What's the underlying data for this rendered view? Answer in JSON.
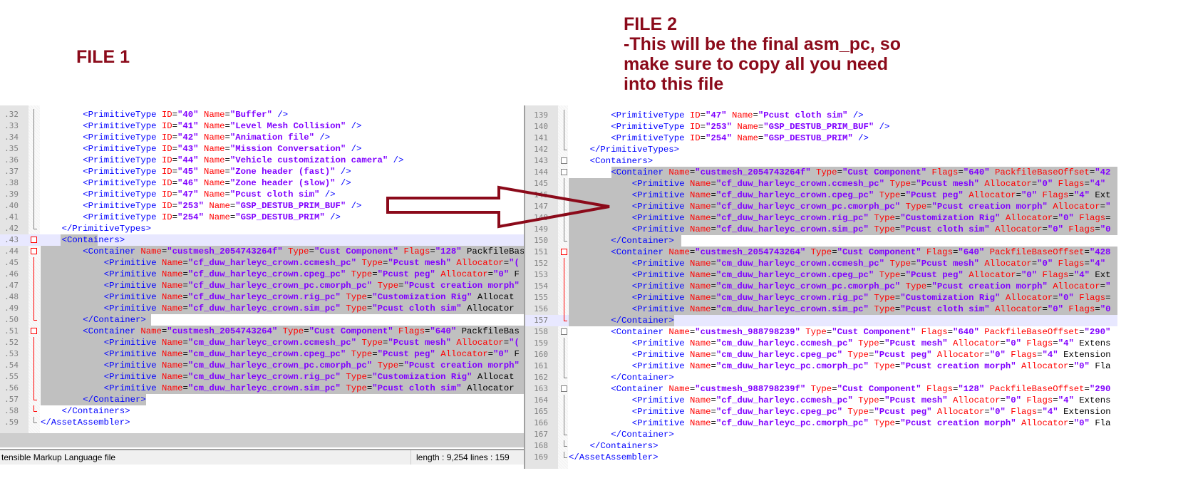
{
  "annotations": {
    "file1_title": "FILE 1",
    "file2_title": "FILE 2",
    "file2_note": [
      "-This will be the final asm_pc, so",
      "make sure to copy all you need",
      "into this file"
    ],
    "accent_color": "#8b0a1a",
    "arrow": "right-arrow-outline"
  },
  "left_editor": {
    "status": {
      "file_type": "tensible Markup Language file",
      "length": "length : 9,254",
      "lines": "lines : 159"
    },
    "lines": [
      {
        "n": ".32",
        "d": 2,
        "text": "<PrimitiveType ID=\"40\" Name=\"Buffer\" />"
      },
      {
        "n": ".33",
        "d": 2,
        "text": "<PrimitiveType ID=\"41\" Name=\"Level Mesh Collision\" />"
      },
      {
        "n": ".34",
        "d": 2,
        "text": "<PrimitiveType ID=\"42\" Name=\"Animation file\" />"
      },
      {
        "n": ".35",
        "d": 2,
        "text": "<PrimitiveType ID=\"43\" Name=\"Mission Conversation\" />"
      },
      {
        "n": ".36",
        "d": 2,
        "text": "<PrimitiveType ID=\"44\" Name=\"Vehicle customization camera\" />"
      },
      {
        "n": ".37",
        "d": 2,
        "text": "<PrimitiveType ID=\"45\" Name=\"Zone header (fast)\" />"
      },
      {
        "n": ".38",
        "d": 2,
        "text": "<PrimitiveType ID=\"46\" Name=\"Zone header (slow)\" />"
      },
      {
        "n": ".39",
        "d": 2,
        "text": "<PrimitiveType ID=\"47\" Name=\"Pcust cloth sim\" />"
      },
      {
        "n": ".40",
        "d": 2,
        "text": "<PrimitiveType ID=\"253\" Name=\"GSP_DESTUB_PRIM_BUF\" />"
      },
      {
        "n": ".41",
        "d": 2,
        "text": "<PrimitiveType ID=\"254\" Name=\"GSP_DESTUB_PRIM\" />"
      },
      {
        "n": ".42",
        "d": 1,
        "text": "</PrimitiveTypes>"
      },
      {
        "n": ".43",
        "d": 1,
        "text": "<Containers>"
      },
      {
        "n": ".44",
        "d": 2,
        "text": "<Container Name=\"custmesh_2054743264f\" Type=\"Cust Component\" Flags=\"128\" PackfileBas"
      },
      {
        "n": ".45",
        "d": 3,
        "text": "<Primitive Name=\"cf_duw_harleyc_crown.ccmesh_pc\" Type=\"Pcust mesh\" Allocator=\"("
      },
      {
        "n": ".46",
        "d": 3,
        "text": "<Primitive Name=\"cf_duw_harleyc_crown.cpeg_pc\" Type=\"Pcust peg\" Allocator=\"0\" F"
      },
      {
        "n": ".47",
        "d": 3,
        "text": "<Primitive Name=\"cf_duw_harleyc_crown_pc.cmorph_pc\" Type=\"Pcust creation morph\""
      },
      {
        "n": ".48",
        "d": 3,
        "text": "<Primitive Name=\"cf_duw_harleyc_crown.rig_pc\" Type=\"Customization Rig\" Allocat"
      },
      {
        "n": ".49",
        "d": 3,
        "text": "<Primitive Name=\"cf_duw_harleyc_crown.sim_pc\" Type=\"Pcust cloth sim\" Allocator"
      },
      {
        "n": ".50",
        "d": 2,
        "text": "</Container>"
      },
      {
        "n": ".51",
        "d": 2,
        "text": "<Container Name=\"custmesh_2054743264\" Type=\"Cust Component\" Flags=\"640\" PackfileBas"
      },
      {
        "n": ".52",
        "d": 3,
        "text": "<Primitive Name=\"cm_duw_harleyc_crown.ccmesh_pc\" Type=\"Pcust mesh\" Allocator=\"("
      },
      {
        "n": ".53",
        "d": 3,
        "text": "<Primitive Name=\"cm_duw_harleyc_crown.cpeg_pc\" Type=\"Pcust peg\" Allocator=\"0\" F"
      },
      {
        "n": ".54",
        "d": 3,
        "text": "<Primitive Name=\"cm_duw_harleyc_crown_pc.cmorph_pc\" Type=\"Pcust creation morph\""
      },
      {
        "n": ".55",
        "d": 3,
        "text": "<Primitive Name=\"cm_duw_harleyc_crown.rig_pc\" Type=\"Customization Rig\" Allocat"
      },
      {
        "n": ".56",
        "d": 3,
        "text": "<Primitive Name=\"cm_duw_harleyc_crown.sim_pc\" Type=\"Pcust cloth sim\" Allocator"
      },
      {
        "n": ".57",
        "d": 2,
        "text": "</Container>"
      },
      {
        "n": ".58",
        "d": 1,
        "text": "</Containers>"
      },
      {
        "n": ".59",
        "d": 0,
        "text": "</AssetAssembler>"
      }
    ]
  },
  "right_editor": {
    "lines": [
      {
        "n": "139",
        "d": 2,
        "text": "<PrimitiveType ID=\"47\" Name=\"Pcust cloth sim\" />"
      },
      {
        "n": "140",
        "d": 2,
        "text": "<PrimitiveType ID=\"253\" Name=\"GSP_DESTUB_PRIM_BUF\" />"
      },
      {
        "n": "141",
        "d": 2,
        "text": "<PrimitiveType ID=\"254\" Name=\"GSP_DESTUB_PRIM\" />"
      },
      {
        "n": "142",
        "d": 1,
        "text": "</PrimitiveTypes>"
      },
      {
        "n": "143",
        "d": 1,
        "text": "<Containers>"
      },
      {
        "n": "144",
        "d": 2,
        "text": "<Container Name=\"custmesh_2054743264f\" Type=\"Cust Component\" Flags=\"640\" PackfileBaseOffset=\"42"
      },
      {
        "n": "145",
        "d": 3,
        "text": "<Primitive Name=\"cf_duw_harleyc_crown.ccmesh_pc\" Type=\"Pcust mesh\" Allocator=\"0\" Flags=\"4\""
      },
      {
        "n": "146",
        "d": 3,
        "text": "<Primitive Name=\"cf_duw_harleyc_crown.cpeg_pc\" Type=\"Pcust peg\" Allocator=\"0\" Flags=\"4\" Ext"
      },
      {
        "n": "147",
        "d": 3,
        "text": "<Primitive Name=\"cf_duw_harleyc_crown_pc.cmorph_pc\" Type=\"Pcust creation morph\" Allocator=\""
      },
      {
        "n": "148",
        "d": 3,
        "text": "<Primitive Name=\"cf_duw_harleyc_crown.rig_pc\" Type=\"Customization Rig\" Allocator=\"0\" Flags="
      },
      {
        "n": "149",
        "d": 3,
        "text": "<Primitive Name=\"cf_duw_harleyc_crown.sim_pc\" Type=\"Pcust cloth sim\" Allocator=\"0\" Flags=\"0"
      },
      {
        "n": "150",
        "d": 2,
        "text": "</Container>"
      },
      {
        "n": "151",
        "d": 2,
        "text": "<Container Name=\"custmesh_2054743264\" Type=\"Cust Component\" Flags=\"640\" PackfileBaseOffset=\"428"
      },
      {
        "n": "152",
        "d": 3,
        "text": "<Primitive Name=\"cm_duw_harleyc_crown.ccmesh_pc\" Type=\"Pcust mesh\" Allocator=\"0\" Flags=\"4\""
      },
      {
        "n": "153",
        "d": 3,
        "text": "<Primitive Name=\"cm_duw_harleyc_crown.cpeg_pc\" Type=\"Pcust peg\" Allocator=\"0\" Flags=\"4\" Ext"
      },
      {
        "n": "154",
        "d": 3,
        "text": "<Primitive Name=\"cm_duw_harleyc_crown_pc.cmorph_pc\" Type=\"Pcust creation morph\" Allocator=\""
      },
      {
        "n": "155",
        "d": 3,
        "text": "<Primitive Name=\"cm_duw_harleyc_crown.rig_pc\" Type=\"Customization Rig\" Allocator=\"0\" Flags="
      },
      {
        "n": "156",
        "d": 3,
        "text": "<Primitive Name=\"cm_duw_harleyc_crown.sim_pc\" Type=\"Pcust cloth sim\" Allocator=\"0\" Flags=\"0"
      },
      {
        "n": "157",
        "d": 2,
        "text": "</Container>"
      },
      {
        "n": "158",
        "d": 2,
        "text": "<Container Name=\"custmesh_988798239\" Type=\"Cust Component\" Flags=\"640\" PackfileBaseOffset=\"290\""
      },
      {
        "n": "159",
        "d": 3,
        "text": "<Primitive Name=\"cm_duw_harleyc.ccmesh_pc\" Type=\"Pcust mesh\" Allocator=\"0\" Flags=\"4\" Extens"
      },
      {
        "n": "160",
        "d": 3,
        "text": "<Primitive Name=\"cm_duw_harleyc.cpeg_pc\" Type=\"Pcust peg\" Allocator=\"0\" Flags=\"4\" Extension"
      },
      {
        "n": "161",
        "d": 3,
        "text": "<Primitive Name=\"cm_duw_harleyc_pc.cmorph_pc\" Type=\"Pcust creation morph\" Allocator=\"0\" Fla"
      },
      {
        "n": "162",
        "d": 2,
        "text": "</Container>"
      },
      {
        "n": "163",
        "d": 2,
        "text": "<Container Name=\"custmesh_988798239f\" Type=\"Cust Component\" Flags=\"128\" PackfileBaseOffset=\"290"
      },
      {
        "n": "164",
        "d": 3,
        "text": "<Primitive Name=\"cf_duw_harleyc.ccmesh_pc\" Type=\"Pcust mesh\" Allocator=\"0\" Flags=\"4\" Extens"
      },
      {
        "n": "165",
        "d": 3,
        "text": "<Primitive Name=\"cf_duw_harleyc.cpeg_pc\" Type=\"Pcust peg\" Allocator=\"0\" Flags=\"4\" Extension"
      },
      {
        "n": "166",
        "d": 3,
        "text": "<Primitive Name=\"cf_duw_harleyc_pc.cmorph_pc\" Type=\"Pcust creation morph\" Allocator=\"0\" Fla"
      },
      {
        "n": "167",
        "d": 2,
        "text": "</Container>"
      },
      {
        "n": "168",
        "d": 1,
        "text": "</Containers>"
      },
      {
        "n": "169",
        "d": 0,
        "text": "</AssetAssembler>"
      }
    ]
  }
}
